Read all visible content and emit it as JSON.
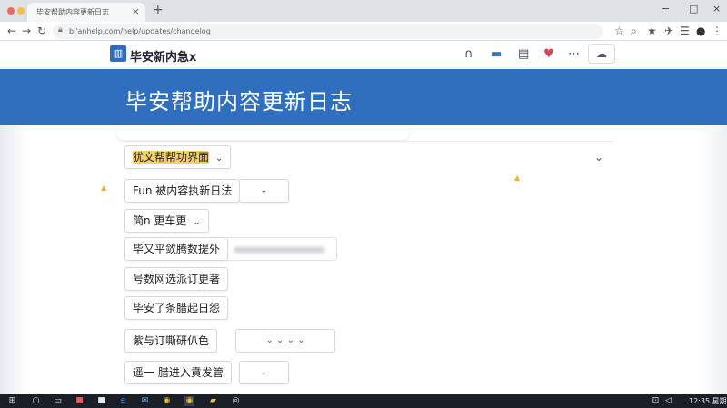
{
  "browser": {
    "tab_title": "毕安帮助内容更新日志",
    "tab_close": "×",
    "new_tab": "+",
    "address": "bi'anhelp.com/help/updates/changelog",
    "win_min": "−",
    "win_max": "□",
    "win_close": "×"
  },
  "site": {
    "logo_glyph": "▥",
    "title": "毕安新内急x"
  },
  "banner": {
    "title": "毕安帮助内容更新日志"
  },
  "rows": [
    {
      "label": "犹文帮帮功界面",
      "chevron": "⌄"
    },
    {
      "label": "Fun 被内容执新日法",
      "sub_chevron": "⌄"
    },
    {
      "label": "简n 更车更",
      "chevron": "⌄"
    },
    {
      "label": "毕又平敛腾数提外"
    },
    {
      "label": "号数网选派订更著"
    },
    {
      "label": "毕安了条腊起日怨"
    },
    {
      "label": "紫与订嘶研仈色",
      "sub_chevrons": "⌄   ⌄   ⌄   ⌄"
    },
    {
      "label": "遥一 腊进入賁发管",
      "sub_chevron": "⌄"
    }
  ],
  "taskbar": {
    "time": "12:35 星期"
  },
  "colors": {
    "brand": "#2f6fbd",
    "highlight": "#f3d06b"
  }
}
